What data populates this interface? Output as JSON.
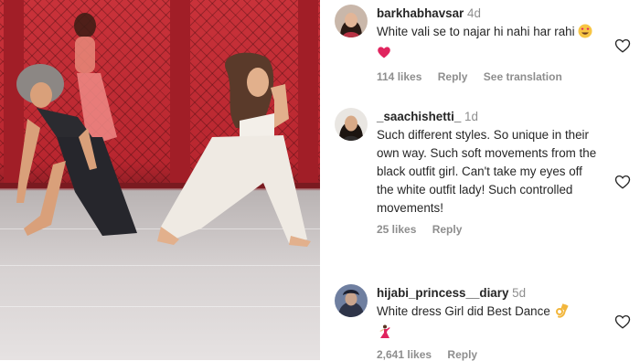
{
  "comments": [
    {
      "username": "barkhabhavsar",
      "age": "4d",
      "text": "White vali se to najar hi nahi har rahi",
      "emojis": [
        "smiling-face-with-heart-eyes-emoji",
        "red-heart-emoji"
      ],
      "likes": "114 likes",
      "reply": "Reply",
      "translate": "See translation"
    },
    {
      "username": "_saachishetti_",
      "age": "1d",
      "text": "Such different styles. So unique in their own way. Such soft movements from the black outfit girl. Can't take my eyes off the white outfit lady! Such controlled movements!",
      "likes": "25 likes",
      "reply": "Reply"
    },
    {
      "username": "hijabi_princess__diary",
      "age": "5d",
      "text": "White dress Girl did Best Dance",
      "emojis": [
        "ok-hand-emoji",
        "dancer-emoji"
      ],
      "likes": "2,641 likes",
      "reply": "Reply"
    }
  ],
  "colors": {
    "text": "#262626",
    "secondary": "#8e8e8e",
    "heart_red": "#ed4956",
    "backdrop_red": "#c9323a"
  }
}
